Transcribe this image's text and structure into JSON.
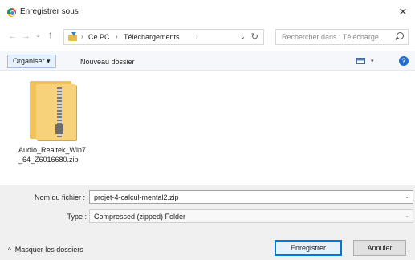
{
  "window": {
    "title": "Enregistrer sous",
    "close_glyph": "✕",
    "app_icon": "chrome-icon"
  },
  "nav": {
    "back_glyph": "←",
    "forward_glyph": "→",
    "recent_glyph": "⌄",
    "up_glyph": "↑",
    "breadcrumbs": [
      "Ce PC",
      "Téléchargements"
    ],
    "crumb_sep": "›",
    "dropdown_glyph": "⌄",
    "refresh_glyph": "↻",
    "search_placeholder": "Rechercher dans : Télécharge..."
  },
  "toolbar": {
    "organize_label": "Organiser ▾",
    "new_folder_label": "Nouveau dossier",
    "view_dropdown_glyph": "▾",
    "help_glyph": "?"
  },
  "files": [
    {
      "name": "Audio_Realtek_Win7_64_Z6016680.zip",
      "icon": "zip-folder-icon"
    }
  ],
  "form": {
    "filename_label": "Nom du fichier :",
    "filename_value": "projet-4-calcul-mental2.zip",
    "type_label": "Type :",
    "type_value": "Compressed (zipped) Folder",
    "dropdown_glyph": "⌄"
  },
  "footer": {
    "hide_folders_label": "Masquer les dossiers",
    "hide_folders_glyph": "^",
    "save_label": "Enregistrer",
    "cancel_label": "Annuler"
  },
  "colors": {
    "accent": "#0078d7",
    "folder": "#f7d27a"
  }
}
